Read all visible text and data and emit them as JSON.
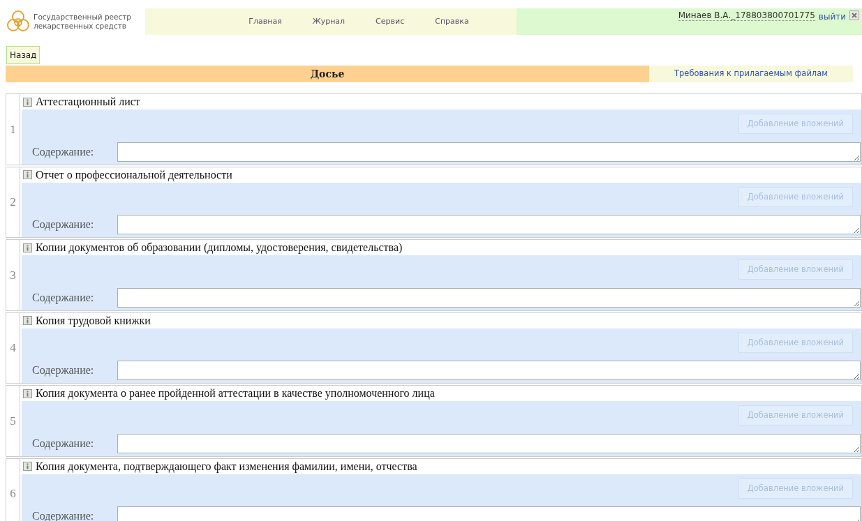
{
  "header": {
    "logo_lines": [
      "Государственный реестр",
      "лекарственных средств"
    ],
    "menu": [
      "Главная",
      "Журнал",
      "Сервис",
      "Справка"
    ],
    "user": "Минаев В.А._178803800701775",
    "logout": "выйти"
  },
  "back_button": "Назад",
  "title_bar": {
    "title": "Досье",
    "link": "Требования к прилагаемым файлам"
  },
  "sections": [
    {
      "number": "1",
      "title": "Аттестационный лист",
      "button": {
        "label": "Добавление вложений",
        "disabled": true
      },
      "content_label": "Содержание:"
    },
    {
      "number": "2",
      "title": "Отчет о профессиональной деятельности",
      "button": {
        "label": "Добавление вложений",
        "disabled": true
      },
      "content_label": "Содержание:"
    },
    {
      "number": "3",
      "title": "Копии документов об образовании (дипломы, удостоверения, свидетельства)",
      "button": {
        "label": "Добавление вложений",
        "disabled": true
      },
      "content_label": "Содержание:"
    },
    {
      "number": "4",
      "title": "Копия трудовой книжки",
      "button": {
        "label": "Добавление вложений",
        "disabled": true
      },
      "content_label": "Содержание:"
    },
    {
      "number": "5",
      "title": "Копия документа о ранее пройденной аттестации в качестве уполномоченного лица",
      "button": {
        "label": "Добавление вложений",
        "disabled": true
      },
      "content_label": "Содержание:"
    },
    {
      "number": "6",
      "title": "Копия документа, подтверждающего факт изменения фамилии, имени, отчества",
      "button": {
        "label": "Добавление вложений",
        "disabled": true
      },
      "content_label": "Содержание:"
    }
  ]
}
